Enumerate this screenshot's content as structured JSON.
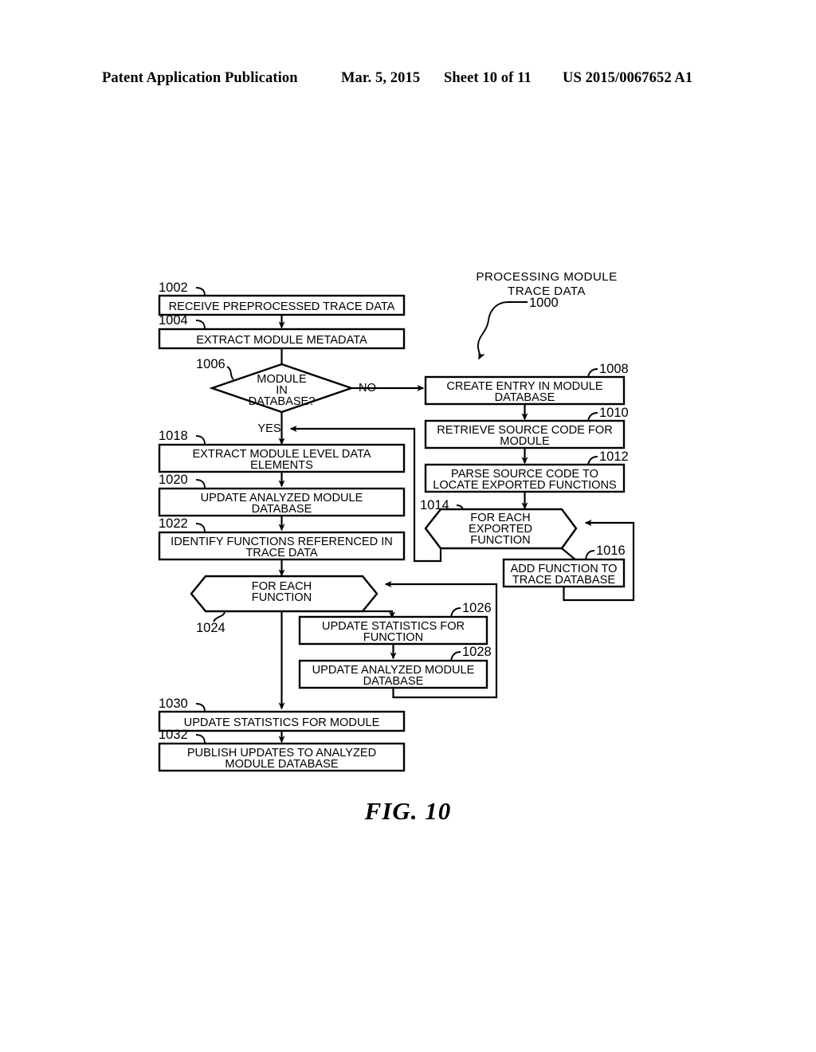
{
  "header": {
    "publication": "Patent Application Publication",
    "date": "Mar. 5, 2015",
    "sheet": "Sheet 10 of 11",
    "number": "US 2015/0067652 A1"
  },
  "figure": {
    "caption": "FIG. 10",
    "title_line1": "PROCESSING MODULE",
    "title_line2": "TRACE DATA",
    "title_ref": "1000"
  },
  "labels": {
    "no": "NO",
    "yes": "YES"
  },
  "nodes": [
    {
      "ref": "1002",
      "type": "process",
      "lines": [
        "RECEIVE PREPROCESSED TRACE DATA"
      ]
    },
    {
      "ref": "1004",
      "type": "process",
      "lines": [
        "EXTRACT MODULE METADATA"
      ]
    },
    {
      "ref": "1006",
      "type": "decision",
      "lines": [
        "MODULE",
        "IN",
        "DATABASE?"
      ]
    },
    {
      "ref": "1008",
      "type": "process",
      "lines": [
        "CREATE ENTRY IN MODULE",
        "DATABASE"
      ]
    },
    {
      "ref": "1010",
      "type": "process",
      "lines": [
        "RETRIEVE SOURCE CODE FOR",
        "MODULE"
      ]
    },
    {
      "ref": "1012",
      "type": "process",
      "lines": [
        "PARSE SOURCE CODE TO",
        "LOCATE EXPORTED FUNCTIONS"
      ]
    },
    {
      "ref": "1014",
      "type": "loop",
      "lines": [
        "FOR EACH",
        "EXPORTED",
        "FUNCTION"
      ]
    },
    {
      "ref": "1016",
      "type": "process",
      "lines": [
        "ADD FUNCTION TO",
        "TRACE DATABASE"
      ]
    },
    {
      "ref": "1018",
      "type": "process",
      "lines": [
        "EXTRACT MODULE LEVEL DATA",
        "ELEMENTS"
      ]
    },
    {
      "ref": "1020",
      "type": "process",
      "lines": [
        "UPDATE ANALYZED MODULE",
        "DATABASE"
      ]
    },
    {
      "ref": "1022",
      "type": "process",
      "lines": [
        "IDENTIFY FUNCTIONS REFERENCED IN",
        "TRACE DATA"
      ]
    },
    {
      "ref": "1024",
      "type": "loop",
      "lines": [
        "FOR EACH",
        "FUNCTION"
      ]
    },
    {
      "ref": "1026",
      "type": "process",
      "lines": [
        "UPDATE STATISTICS FOR",
        "FUNCTION"
      ]
    },
    {
      "ref": "1028",
      "type": "process",
      "lines": [
        "UPDATE ANALYZED MODULE",
        "DATABASE"
      ]
    },
    {
      "ref": "1030",
      "type": "process",
      "lines": [
        "UPDATE STATISTICS FOR MODULE"
      ]
    },
    {
      "ref": "1032",
      "type": "process",
      "lines": [
        "PUBLISH UPDATES TO ANALYZED",
        "MODULE DATABASE"
      ]
    }
  ]
}
